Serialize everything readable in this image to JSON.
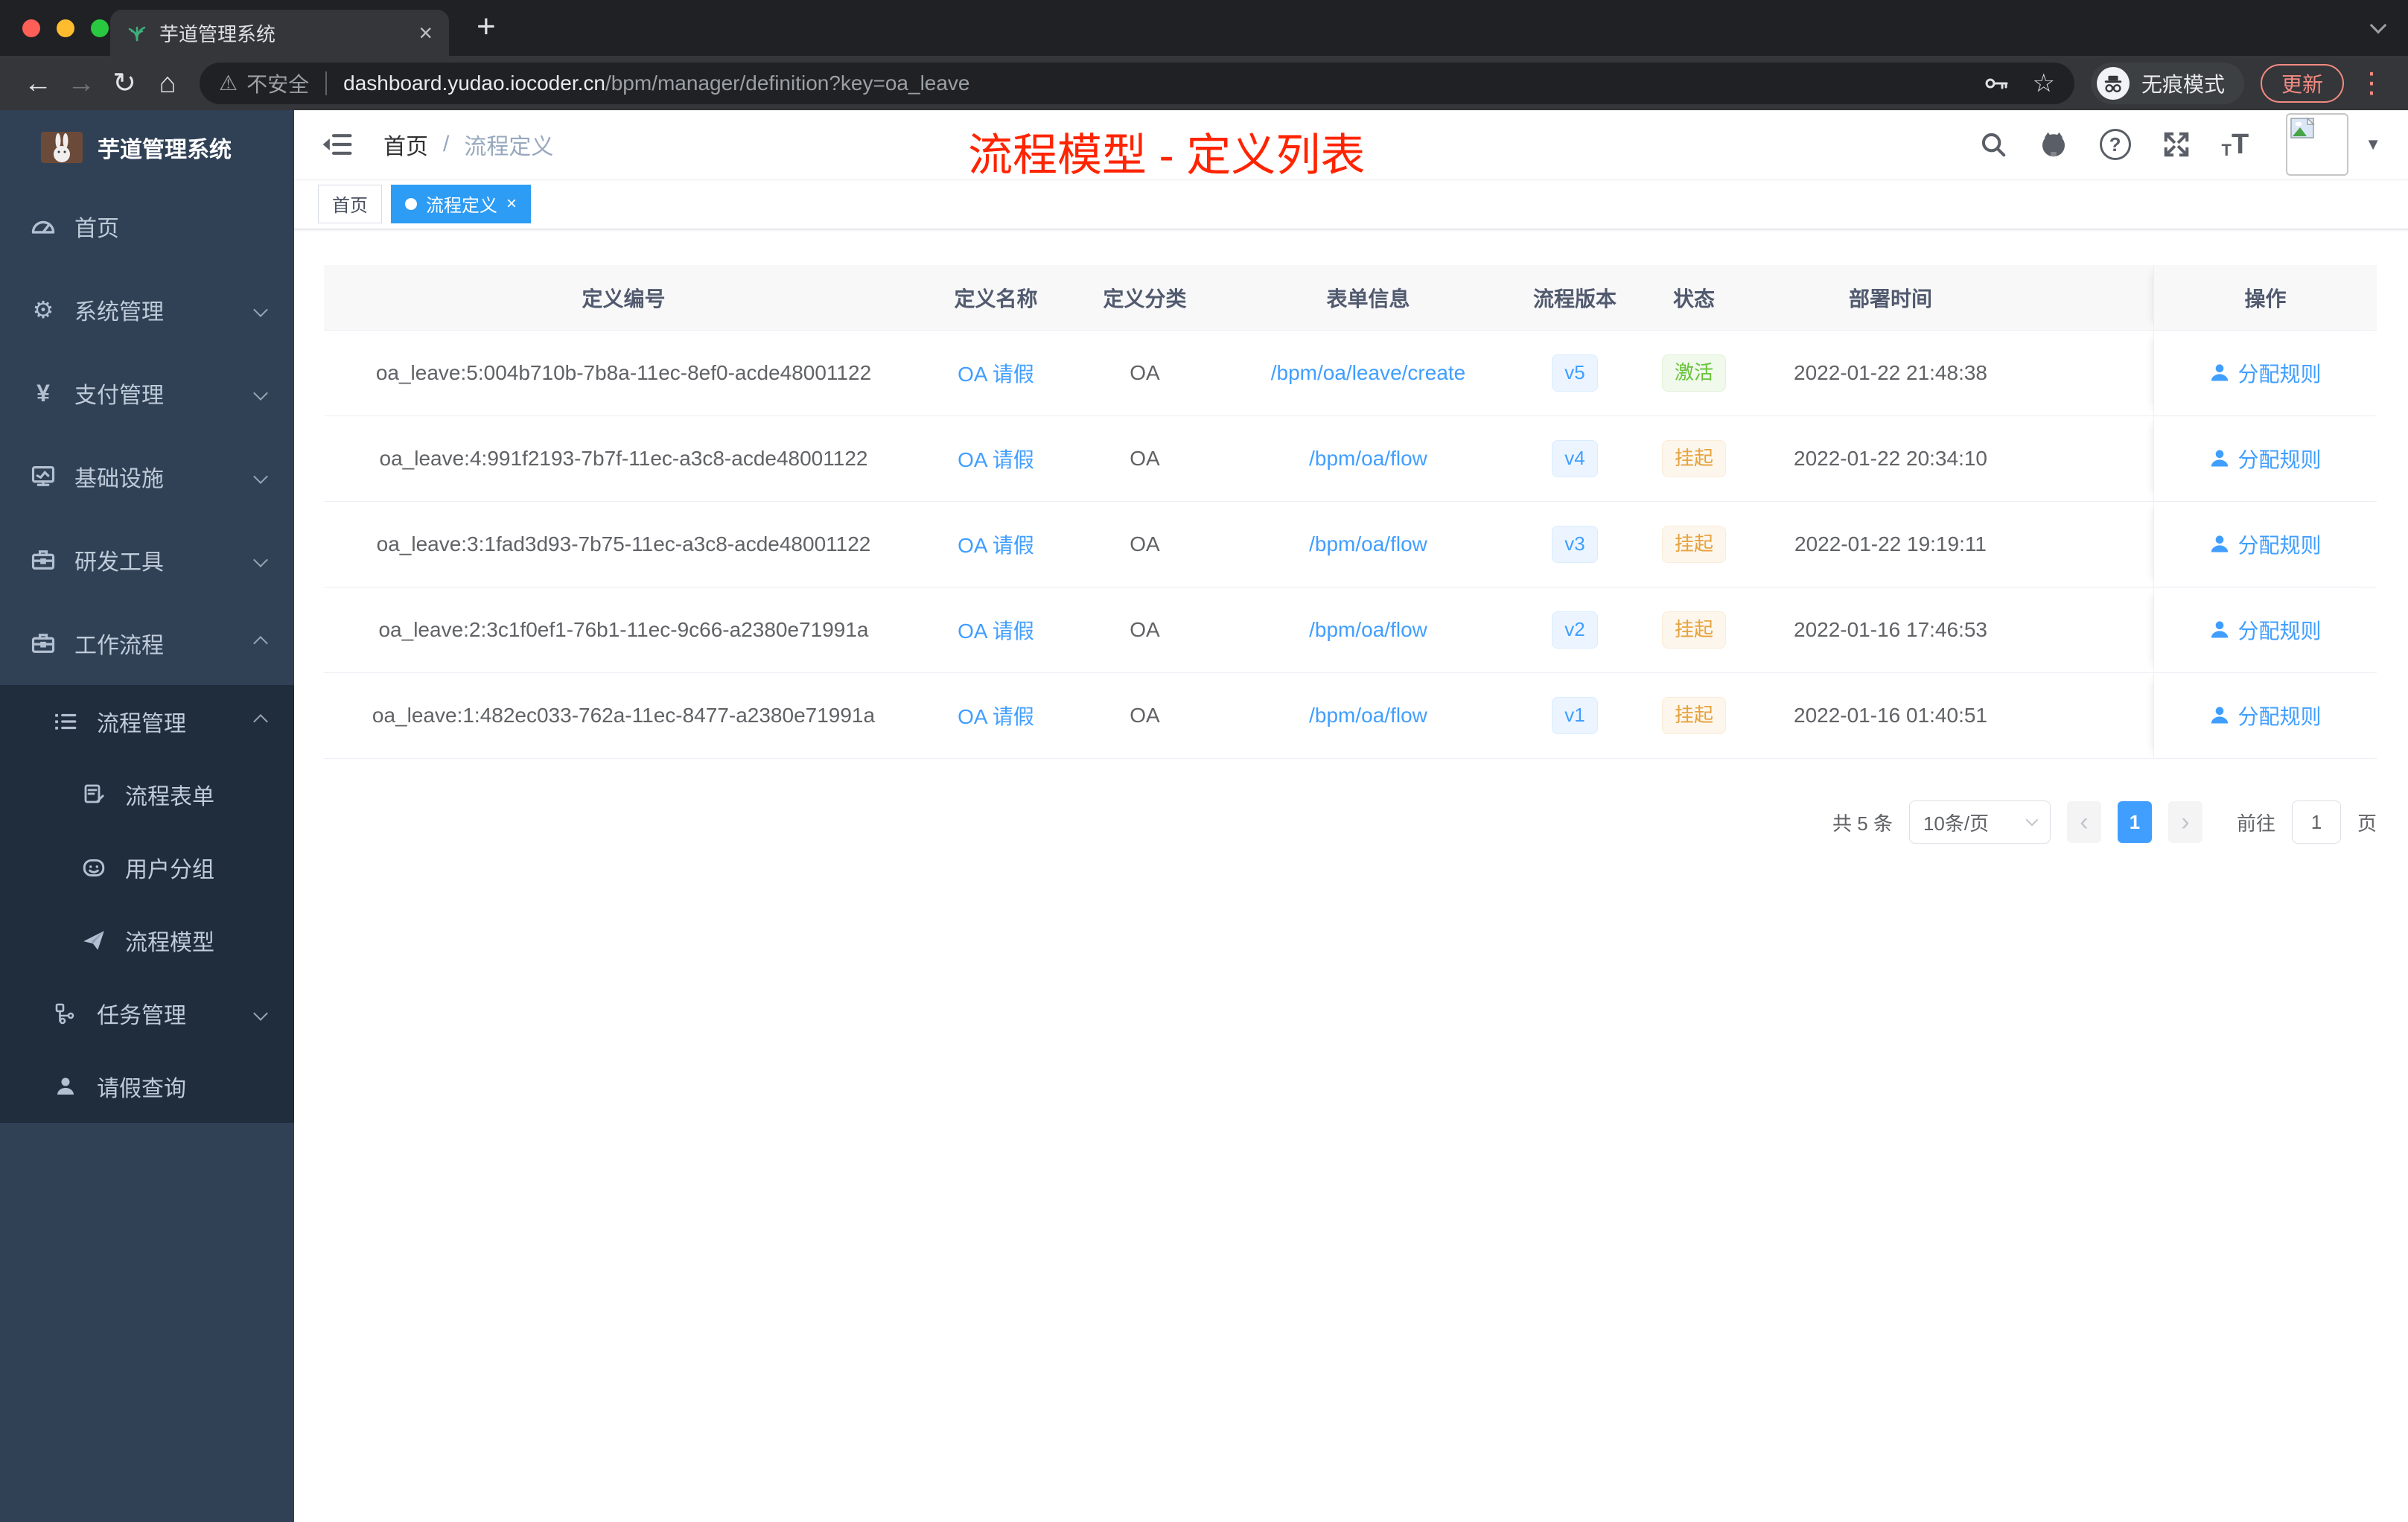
{
  "browser": {
    "tab_title": "芋道管理系统",
    "security_label": "不安全",
    "url_host": "dashboard.yudao.iocoder.cn",
    "url_path": "/bpm/manager/definition?key=oa_leave",
    "incognito_label": "无痕模式",
    "update_label": "更新"
  },
  "icons": {
    "close": "×",
    "plus": "+",
    "back": "←",
    "forward": "→",
    "reload": "↻",
    "home": "⌂",
    "warning": "⚠",
    "star": "☆",
    "menu_dots": "⋮",
    "caret_down": "▼",
    "question": "?",
    "gear": "⚙",
    "yen": "¥",
    "font_small": "T",
    "font_large": "T",
    "prev": "‹",
    "next": "›",
    "tag_close": "×"
  },
  "sidebar": {
    "title": "芋道管理系统",
    "items": [
      {
        "label": "首页"
      },
      {
        "label": "系统管理"
      },
      {
        "label": "支付管理"
      },
      {
        "label": "基础设施"
      },
      {
        "label": "研发工具"
      },
      {
        "label": "工作流程"
      }
    ],
    "submenu": [
      {
        "label": "流程管理"
      },
      {
        "label": "流程表单"
      },
      {
        "label": "用户分组"
      },
      {
        "label": "流程模型"
      },
      {
        "label": "任务管理"
      },
      {
        "label": "请假查询"
      }
    ]
  },
  "navbar": {
    "breadcrumb_home": "首页",
    "breadcrumb_sep": "/",
    "breadcrumb_current": "流程定义",
    "annotation": "流程模型 - 定义列表"
  },
  "tags": [
    {
      "label": "首页"
    },
    {
      "label": "流程定义"
    }
  ],
  "table": {
    "columns": [
      "定义编号",
      "定义名称",
      "定义分类",
      "表单信息",
      "流程版本",
      "状态",
      "部署时间",
      "操作"
    ],
    "action_label": "分配规则",
    "rows": [
      {
        "id": "oa_leave:5:004b710b-7b8a-11ec-8ef0-acde48001122",
        "name": "OA 请假",
        "category": "OA",
        "form": "/bpm/oa/leave/create",
        "version": "v5",
        "status": "激活",
        "deploy_time": "2022-01-22 21:48:38"
      },
      {
        "id": "oa_leave:4:991f2193-7b7f-11ec-a3c8-acde48001122",
        "name": "OA 请假",
        "category": "OA",
        "form": "/bpm/oa/flow",
        "version": "v4",
        "status": "挂起",
        "deploy_time": "2022-01-22 20:34:10"
      },
      {
        "id": "oa_leave:3:1fad3d93-7b75-11ec-a3c8-acde48001122",
        "name": "OA 请假",
        "category": "OA",
        "form": "/bpm/oa/flow",
        "version": "v3",
        "status": "挂起",
        "deploy_time": "2022-01-22 19:19:11"
      },
      {
        "id": "oa_leave:2:3c1f0ef1-76b1-11ec-9c66-a2380e71991a",
        "name": "OA 请假",
        "category": "OA",
        "form": "/bpm/oa/flow",
        "version": "v2",
        "status": "挂起",
        "deploy_time": "2022-01-16 17:46:53"
      },
      {
        "id": "oa_leave:1:482ec033-762a-11ec-8477-a2380e71991a",
        "name": "OA 请假",
        "category": "OA",
        "form": "/bpm/oa/flow",
        "version": "v1",
        "status": "挂起",
        "deploy_time": "2022-01-16 01:40:51"
      }
    ]
  },
  "pagination": {
    "total": "共 5 条",
    "page_size": "10条/页",
    "current_page": "1",
    "goto_label": "前往",
    "goto_value": "1",
    "page_label": "页"
  }
}
